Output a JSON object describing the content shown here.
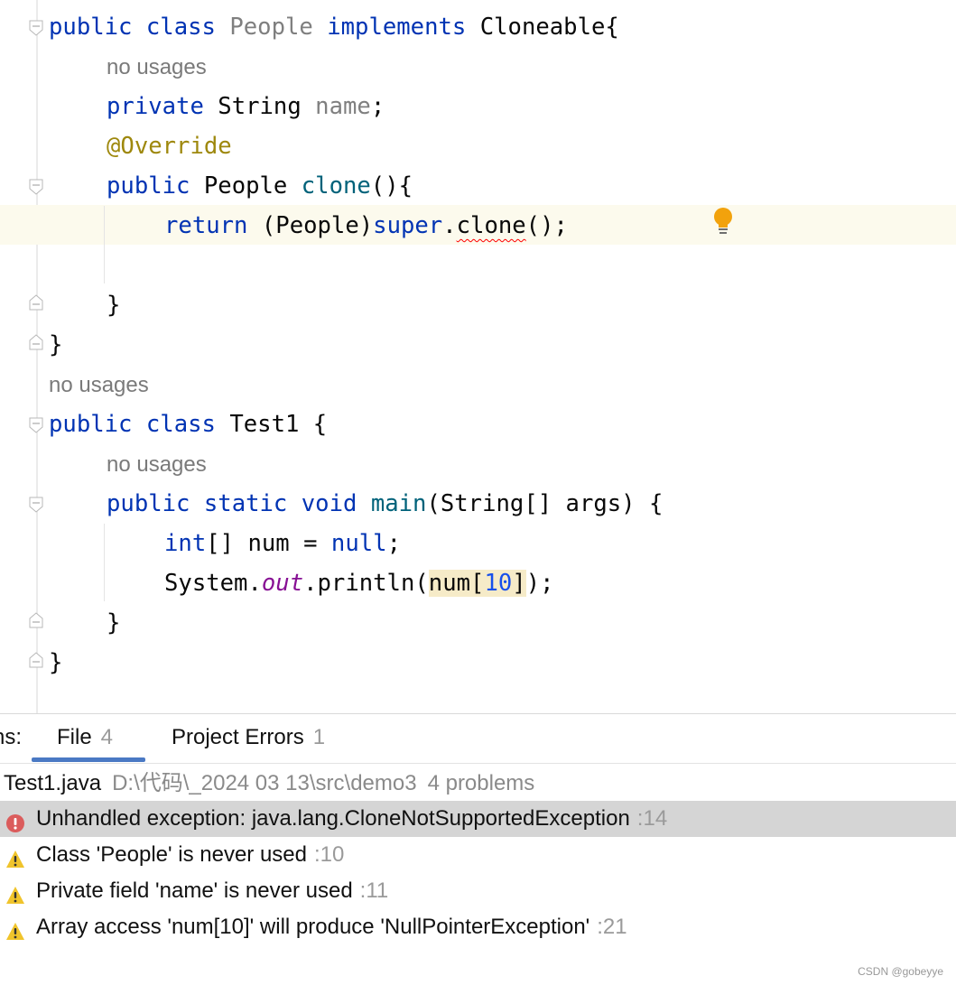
{
  "editor": {
    "hint_no_usages": "no usages",
    "tokens": {
      "public": "public",
      "class": "class",
      "implements": "implements",
      "private": "private",
      "return": "return",
      "super": "super",
      "static": "static",
      "void": "void",
      "int": "int",
      "null": "null",
      "people_gray": "People",
      "cloneable_brace": "Cloneable{",
      "string_type": "String",
      "name_field": "name",
      "semicolon": ";",
      "override": "@Override",
      "people_type": "People",
      "clone": "clone",
      "paren_brace": "(){",
      "cast": "(People)",
      "dot": ".",
      "clone_call": "clone",
      "call_end": "();",
      "close_brace": "}",
      "test1_brace": "Test1 {",
      "main": "main",
      "main_params": "(String[] args) {",
      "int_decl": "[] num = ",
      "system": "System.",
      "out": "out",
      "println": ".println(",
      "num_open": "num[",
      "ten": "10",
      "bracket_close": "]",
      "println_end": ");"
    }
  },
  "panel": {
    "tab_prefix": "ns:",
    "tabs": [
      {
        "label": "File",
        "count": "4"
      },
      {
        "label": "Project Errors",
        "count": "1"
      }
    ],
    "file": {
      "name": "Test1.java",
      "path": "D:\\代码\\_2024 03 13\\src\\demo3",
      "count": "4 problems"
    },
    "problems": [
      {
        "text": "Unhandled exception: java.lang.CloneNotSupportedException",
        "line": ":14",
        "severity": "error"
      },
      {
        "text": "Class 'People' is never used",
        "line": ":10",
        "severity": "warning"
      },
      {
        "text": "Private field 'name' is never used",
        "line": ":11",
        "severity": "warning"
      },
      {
        "text": "Array access 'num[10]' will produce 'NullPointerException'",
        "line": ":21",
        "severity": "warning"
      }
    ]
  },
  "watermark": "CSDN @gobeyye",
  "colors": {
    "keyword": "#0033b3",
    "annotation": "#9e880d",
    "method": "#00627a",
    "number": "#1750eb",
    "static_field": "#871094",
    "error": "#db5c5c",
    "warning": "#f0c42c"
  }
}
